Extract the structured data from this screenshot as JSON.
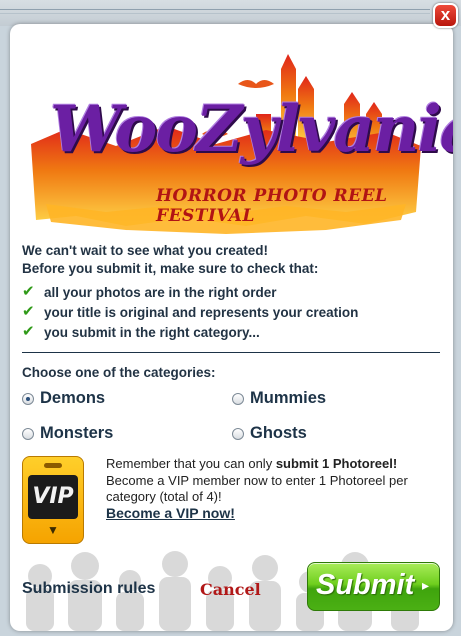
{
  "dialog": {
    "close_label": "x"
  },
  "logo": {
    "title": "WooZylvania",
    "subtitle": "HORROR PHOTO REEL FESTIVAL"
  },
  "intro": {
    "line1": "We can't wait to see what you created!",
    "line2": "Before you submit it, make sure to check that:"
  },
  "checklist": [
    {
      "icon": "check-icon",
      "text": "all your photos are in the right order"
    },
    {
      "icon": "check-icon",
      "text": "your title is original and represents your creation"
    },
    {
      "icon": "check-icon",
      "text": "you submit in the right category..."
    }
  ],
  "categories": {
    "prompt": "Choose one of the categories:",
    "selected": "Demons",
    "options": [
      "Demons",
      "Mummies",
      "Monsters",
      "Ghosts"
    ]
  },
  "vip": {
    "badge_text": "VIP",
    "text_part1": "Remember that you can only ",
    "text_bold": "submit 1 Photoreel!",
    "text_part2": " Become a VIP member now to enter 1 Photoreel per category (total of 4)!",
    "link": "Become a VIP now!"
  },
  "footer": {
    "rules": "Submission rules",
    "cancel": "Cancel",
    "submit": "Submit"
  },
  "colors": {
    "accent_green": "#4bb014",
    "cancel_red": "#b11818",
    "text_dark": "#1d3347",
    "close_red": "#d1281a"
  }
}
